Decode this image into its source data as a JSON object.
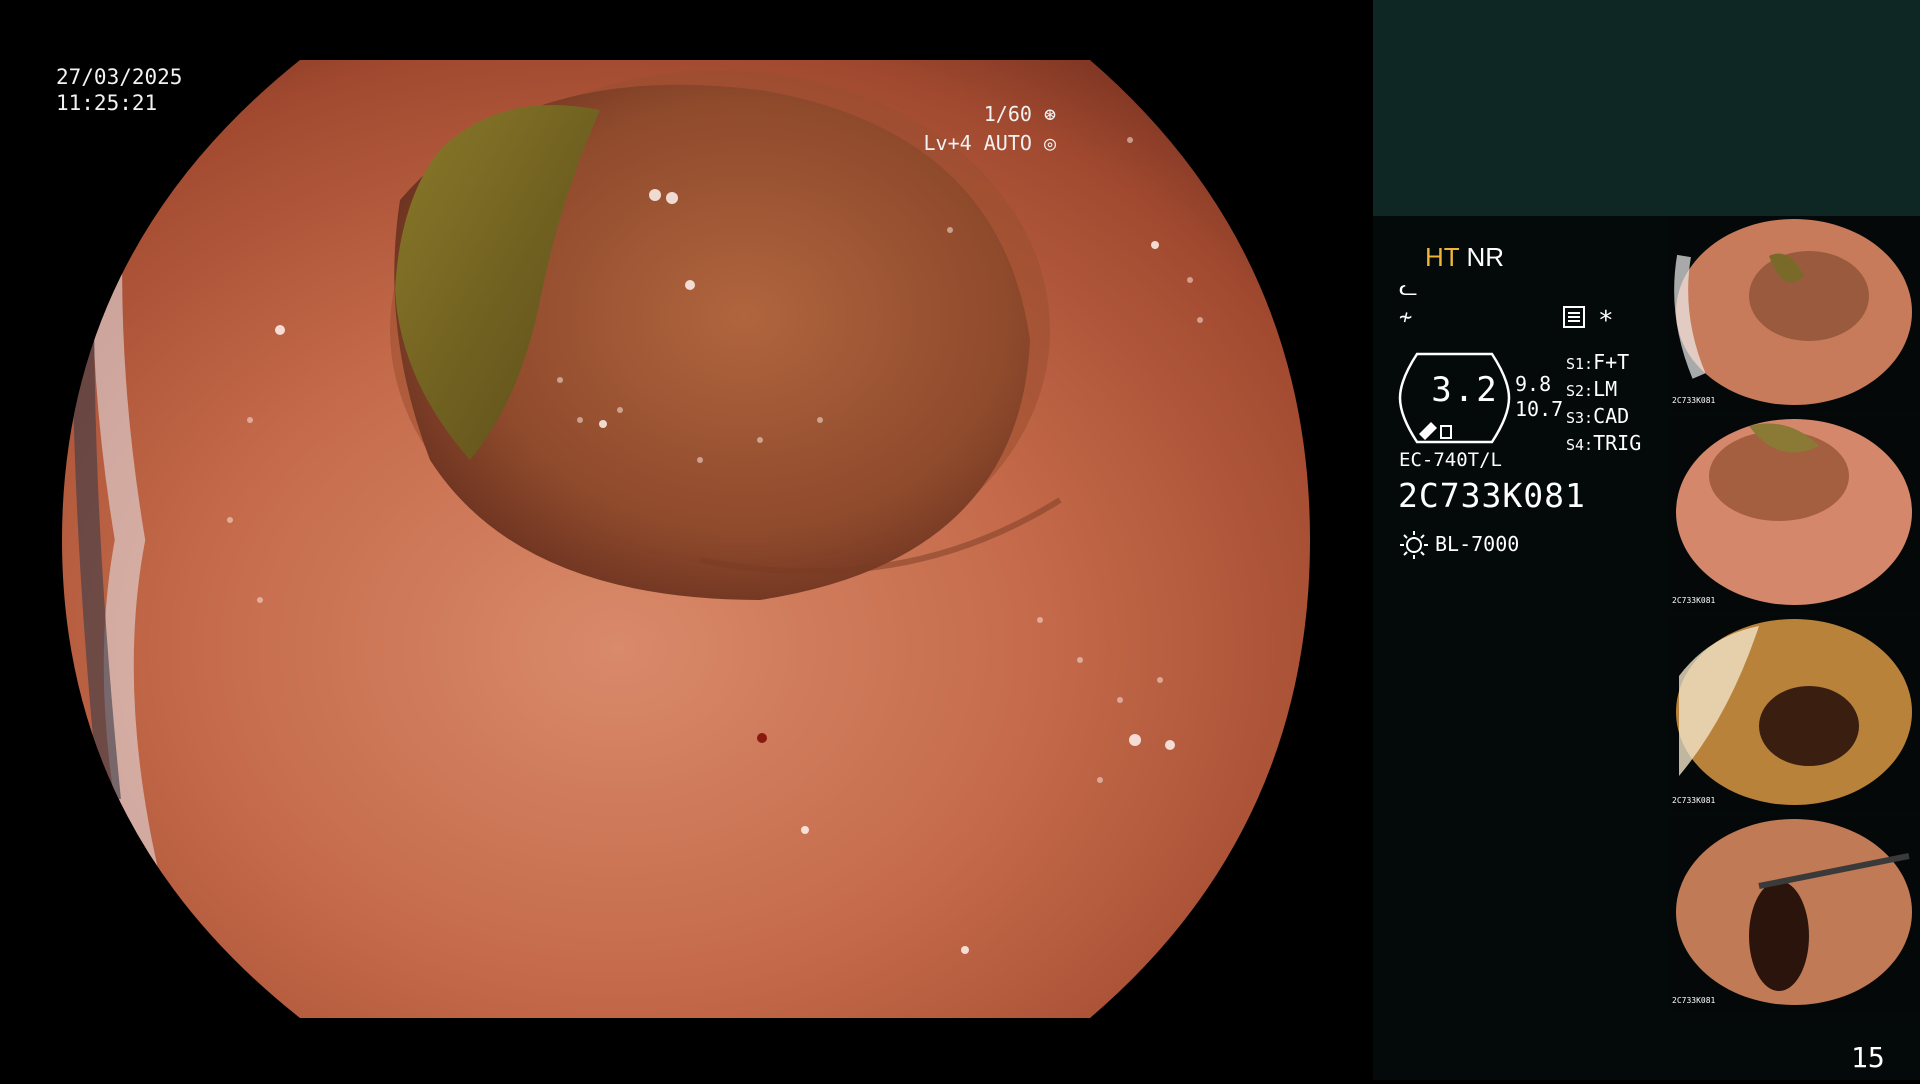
{
  "osd": {
    "date": "27/03/2025",
    "time": "11:25:21",
    "shutter": "1/60",
    "level": "Lv+4",
    "exposure": "AUTO"
  },
  "panel": {
    "mode_ht": "HT",
    "mode_nr": "NR",
    "zoom": "3.2",
    "zoom_a": "9.8",
    "zoom_b": "10.7",
    "switches": [
      {
        "key": "S1:",
        "value": "F+T"
      },
      {
        "key": "S2:",
        "value": "LM"
      },
      {
        "key": "S3:",
        "value": "CAD"
      },
      {
        "key": "S4:",
        "value": "TRIG"
      }
    ],
    "asterisk": "*",
    "scope_model": "EC-740T/L",
    "serial": "2C733K081",
    "light_source": "BL-7000",
    "page_number": "15"
  },
  "thumbnails": [
    {
      "label": "2C733K081"
    },
    {
      "label": "2C733K081"
    },
    {
      "label": "2C733K081"
    },
    {
      "label": "2C733K081"
    }
  ],
  "colors": {
    "side_panel": "#040a0a",
    "side_top": "#0e2624",
    "highlight": "#f0b43a"
  }
}
